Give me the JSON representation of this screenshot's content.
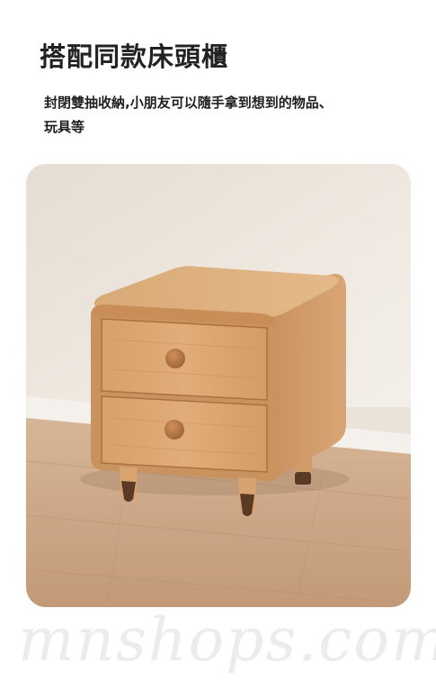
{
  "title": "搭配同款床頭櫃",
  "description": "封閉雙抽收納,小朋友可以隨手拿到想到的物品、玩具等",
  "photo": {
    "subject": "wooden-bedside-cabinet"
  },
  "watermark": "mnshops.com",
  "colors": {
    "wall": "#ece6dd",
    "floor": "#c9a98a",
    "wood": "#d9a874",
    "wood_dark": "#b07a4a",
    "knob": "#b8794a",
    "leg_tip": "#5a3a24"
  }
}
